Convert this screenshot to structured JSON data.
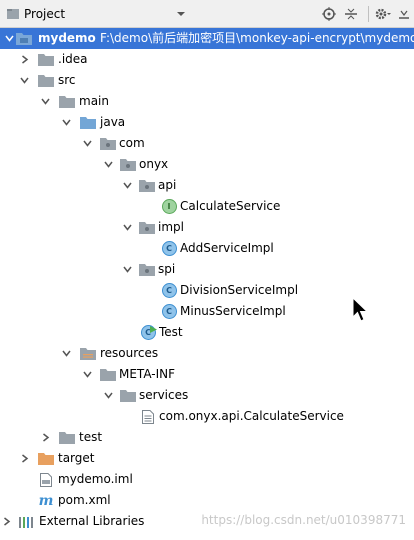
{
  "toolbar": {
    "title": "Project",
    "icons": [
      "project-view-icon",
      "dropdown-arrow-icon",
      "target-icon",
      "collapse-icon",
      "gear-icon",
      "hide-icon"
    ]
  },
  "colors": {
    "selection": "#3875d7",
    "folder_gray": "#9aa3ab",
    "folder_blue": "#73a6d6",
    "folder_orange": "#e8a05f",
    "class_blue": "#3d8fd1",
    "interface_green": "#5aa85a"
  },
  "tree": {
    "root": {
      "name": "mydemo",
      "path": "F:\\demo\\前后端加密项目\\monkey-api-encrypt\\mydemo"
    },
    "idea": ".idea",
    "src": "src",
    "main": "main",
    "java": "java",
    "com": "com",
    "onyx": "onyx",
    "api": "api",
    "calculate_service": "CalculateService",
    "impl": "impl",
    "add_service_impl": "AddServiceImpl",
    "spi": "spi",
    "division_service_impl": "DivisionServiceImpl",
    "minus_service_impl": "MinusServiceImpl",
    "test_class": "Test",
    "resources": "resources",
    "meta_inf": "META-INF",
    "services": "services",
    "service_file": "com.onyx.api.CalculateService",
    "test_folder": "test",
    "target": "target",
    "iml": "mydemo.iml",
    "pom": "pom.xml",
    "external_libraries": "External Libraries"
  },
  "class_badges": {
    "class": "C",
    "interface": "I"
  },
  "watermark": "https://blog.csdn.net/u010398771"
}
